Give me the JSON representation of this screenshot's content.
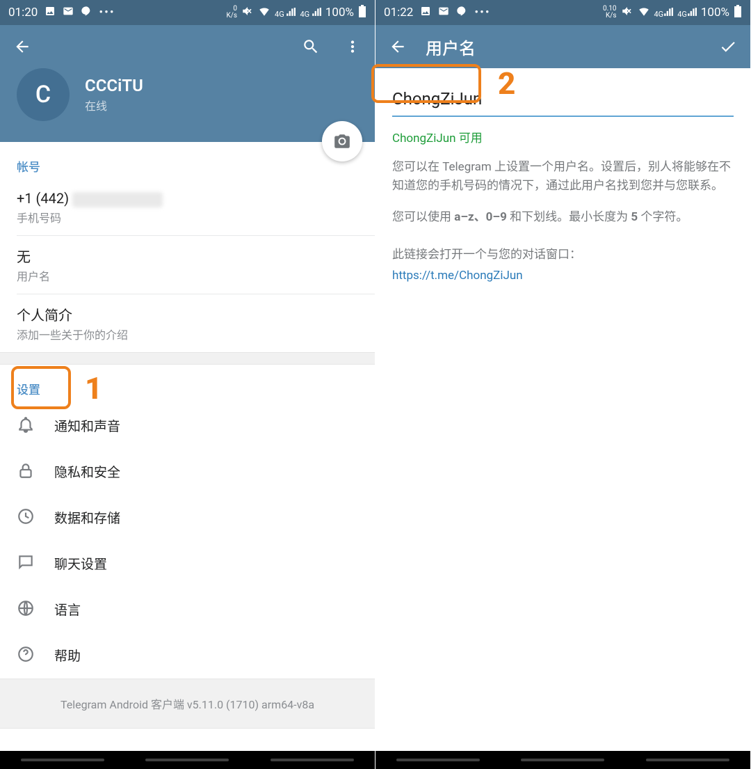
{
  "left": {
    "statusbar": {
      "time": "01:20",
      "speed_top": "0",
      "speed_unit": "K/s",
      "signal_label": "4G",
      "battery": "100%"
    },
    "profile": {
      "avatar_initial": "C",
      "name": "CCCiTU",
      "status": "在线"
    },
    "section_account": "帐号",
    "phone_row": {
      "primary_prefix": "+1 (442) ",
      "secondary": "手机号码"
    },
    "username_row": {
      "primary": "无",
      "secondary": "用户名"
    },
    "bio_row": {
      "primary": "个人简介",
      "secondary": "添加一些关于你的介绍"
    },
    "section_settings": "设置",
    "settings": {
      "notif": "通知和声音",
      "privacy": "隐私和安全",
      "data": "数据和存储",
      "chat": "聊天设置",
      "lang": "语言",
      "help": "帮助"
    },
    "footer": "Telegram Android 客户端 v5.11.0 (1710) arm64-v8a",
    "annot": "1"
  },
  "right": {
    "statusbar": {
      "time": "01:22",
      "speed_top": "0.10",
      "speed_unit": "K/s",
      "signal_label": "4G",
      "battery": "100%"
    },
    "title": "用户名",
    "username_value": "ChongZiJun",
    "availability": "ChongZiJun 可用",
    "desc1": "您可以在 Telegram 上设置一个用户名。设置后，别人将能够在不知道您的手机号码的情况下，通过此用户名找到您并与您联系。",
    "desc2_pre": "您可以使用 ",
    "desc2_bold1": "a–z、0–9",
    "desc2_mid": " 和下划线。最小长度为 ",
    "desc2_bold2": "5",
    "desc2_post": " 个字符。",
    "link_intro": "此链接会打开一个与您的对话窗口：",
    "link": "https://t.me/ChongZiJun",
    "annot": "2"
  }
}
